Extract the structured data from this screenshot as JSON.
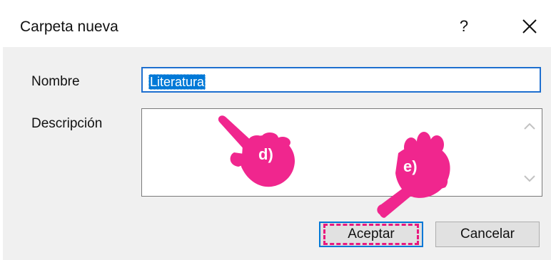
{
  "dialog": {
    "title": "Carpeta nueva",
    "help_label": "?",
    "close_icon": "close-icon"
  },
  "form": {
    "name_label": "Nombre",
    "name_value": "Literatura",
    "description_label": "Descripción",
    "description_value": ""
  },
  "buttons": {
    "ok_label": "Aceptar",
    "cancel_label": "Cancelar"
  },
  "annotations": {
    "step_d": "d)",
    "step_e": "e)"
  },
  "colors": {
    "accent": "#0078d7",
    "annotation": "#e8187f",
    "dialog_background": "#f0f0f0"
  }
}
